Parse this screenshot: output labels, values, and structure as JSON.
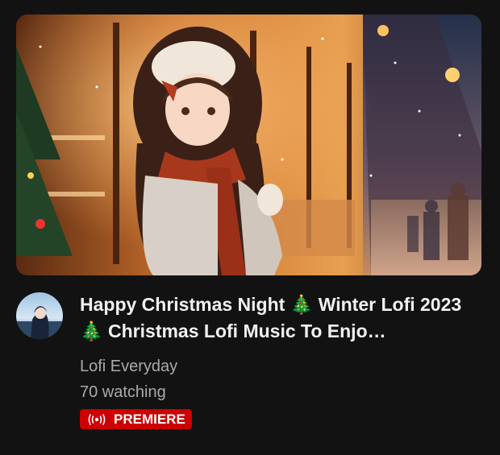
{
  "video": {
    "title": "Happy Christmas Night 🎄 Winter Lofi 2023 🎄 Christmas Lofi Music To Enjo…",
    "channel": "Lofi Everyday",
    "viewers": "70 watching",
    "badge_label": "PREMIERE",
    "thumbnail_icon": "anime-christmas-night-thumbnail",
    "avatar_icon": "channel-avatar",
    "badge_icon": "live-broadcast-icon"
  },
  "colors": {
    "background": "#121212",
    "title": "#f1f1f1",
    "meta": "#aaaaaa",
    "badge": "#cc0000"
  }
}
